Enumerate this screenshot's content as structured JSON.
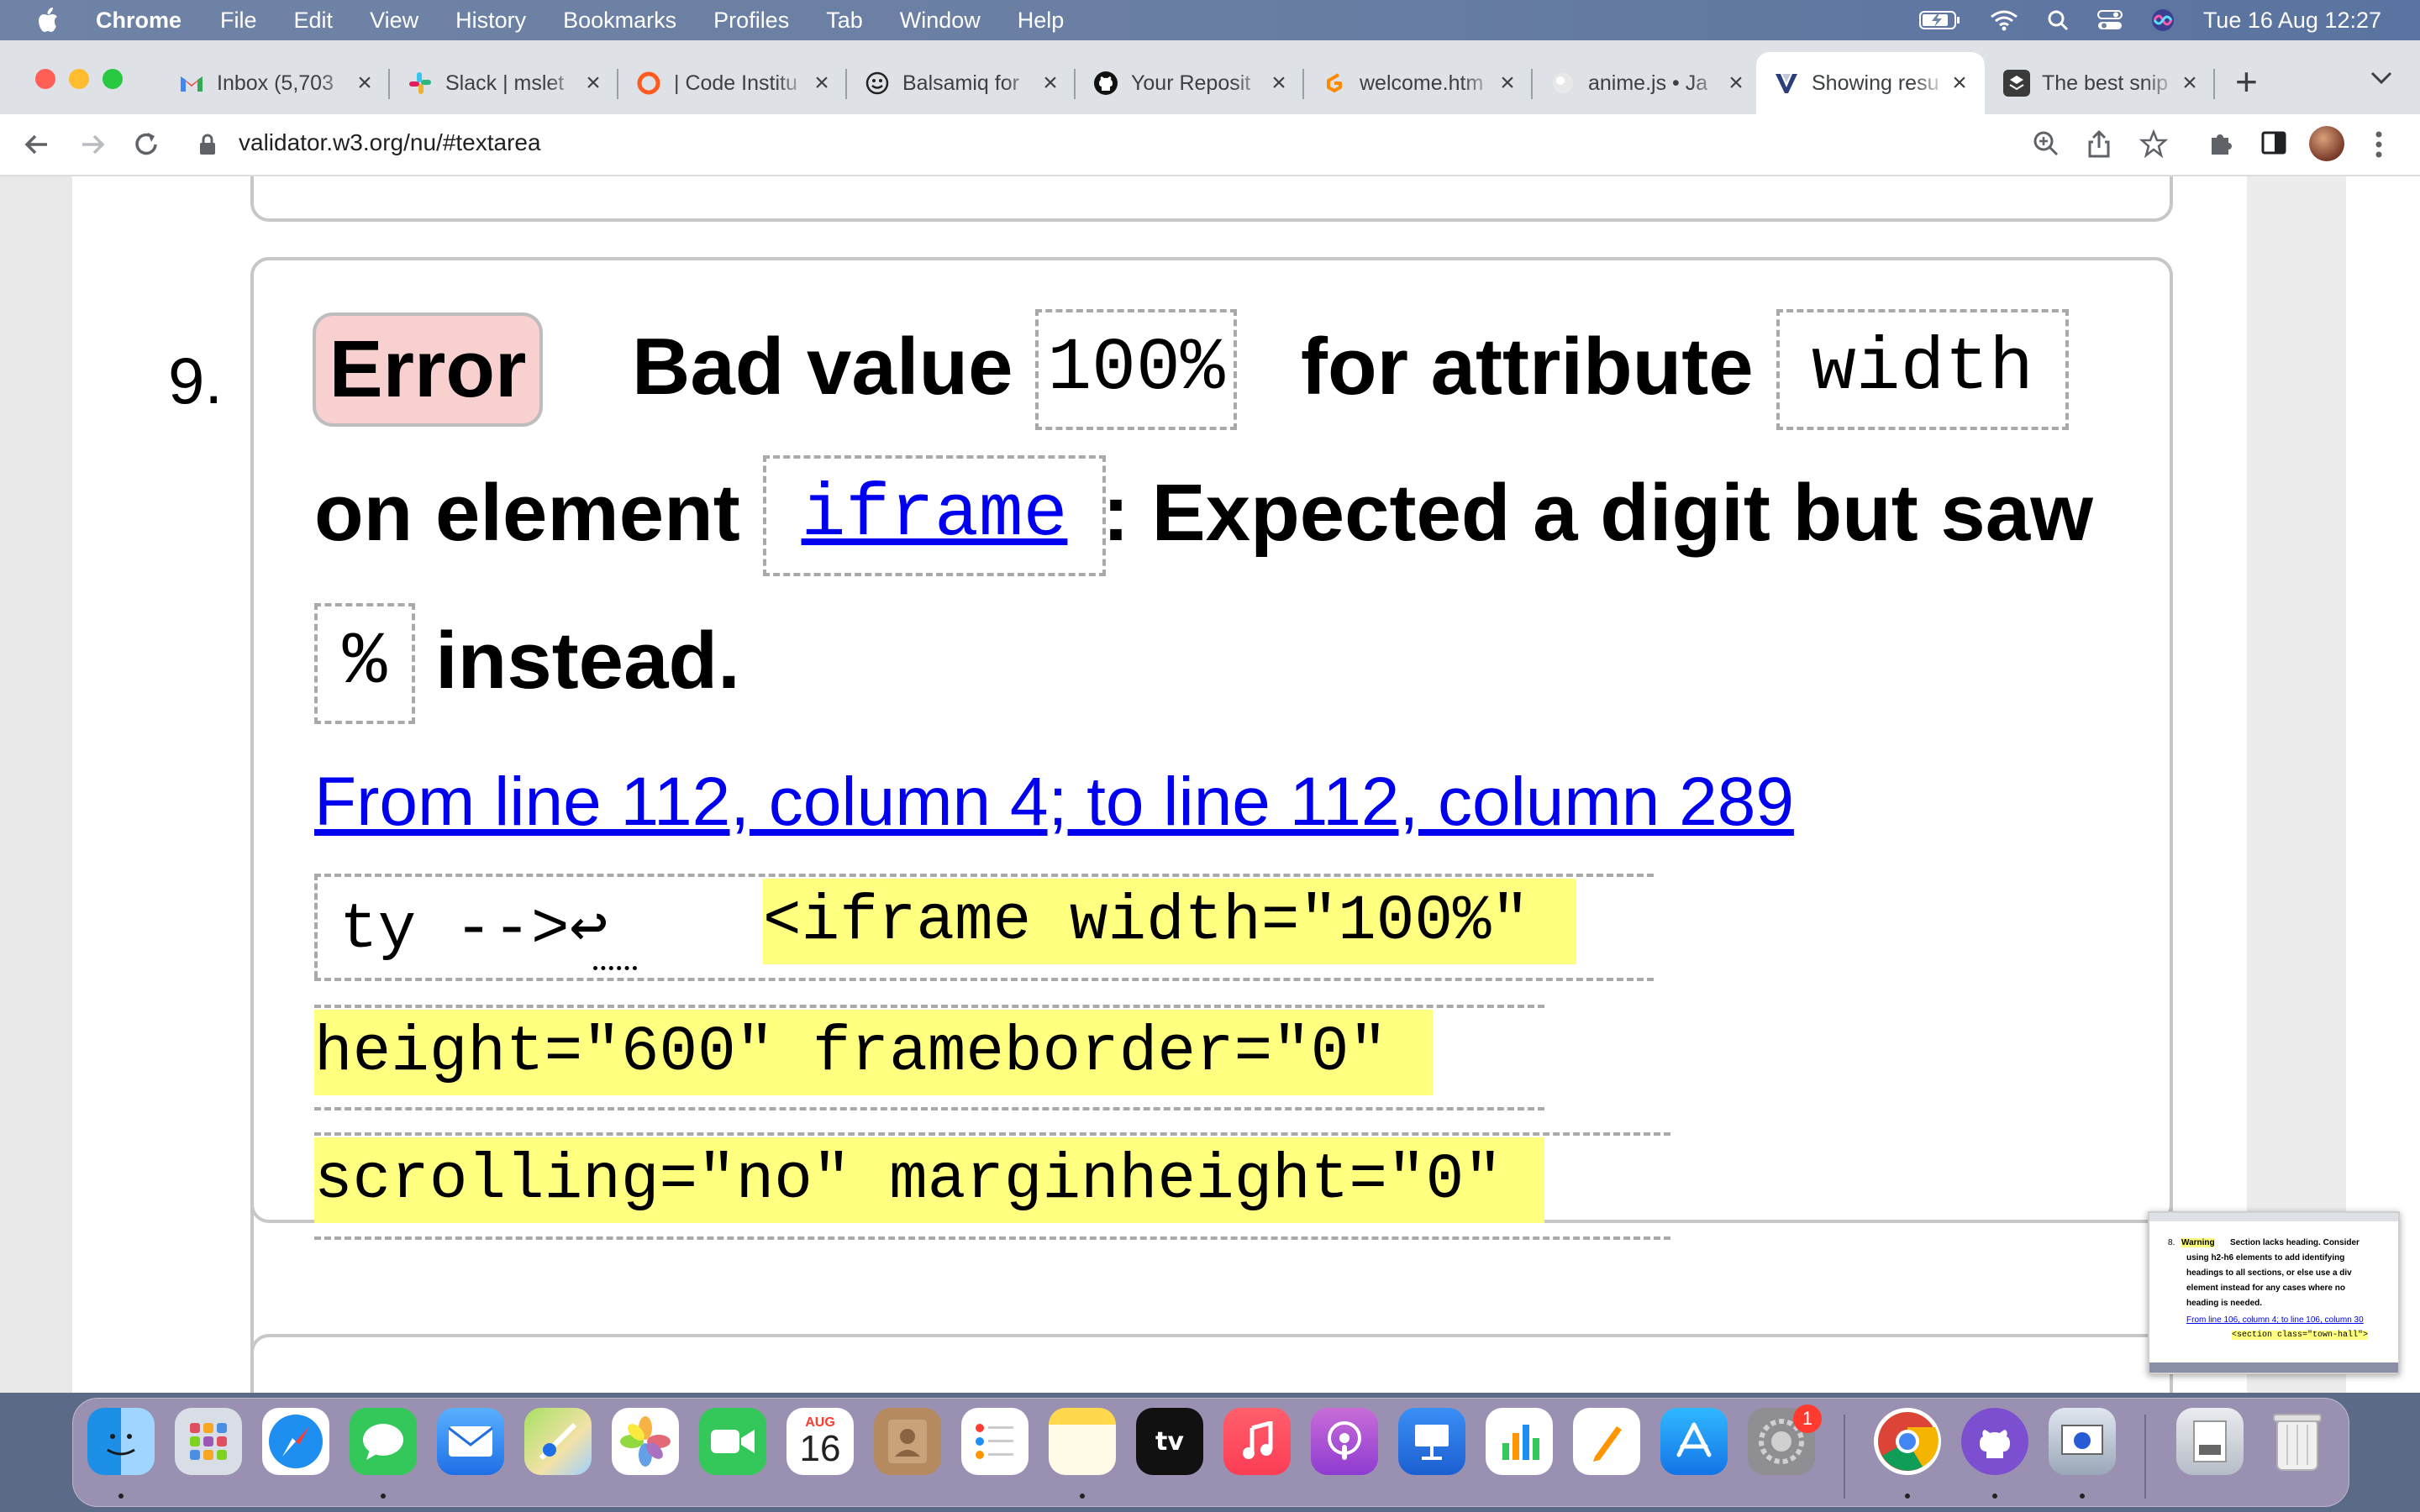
{
  "menubar": {
    "app_name": "Chrome",
    "items": [
      "File",
      "Edit",
      "View",
      "History",
      "Bookmarks",
      "Profiles",
      "Tab",
      "Window",
      "Help"
    ],
    "clock": "Tue 16 Aug  12:27"
  },
  "tabs": [
    {
      "title": "Inbox (5,703",
      "icon": "gmail-icon",
      "active": false
    },
    {
      "title": "Slack | mslet",
      "icon": "slack-icon",
      "active": false
    },
    {
      "title": "| Code Institu",
      "icon": "code-institute-icon",
      "active": false
    },
    {
      "title": "Balsamiq for",
      "icon": "balsamiq-icon",
      "active": false
    },
    {
      "title": "Your Reposit",
      "icon": "github-icon",
      "active": false
    },
    {
      "title": "welcome.htm",
      "icon": "gitpod-icon",
      "active": false
    },
    {
      "title": "anime.js • Ja",
      "icon": "animejs-icon",
      "active": false
    },
    {
      "title": "Showing resu",
      "icon": "w3c-validator-icon",
      "active": true
    },
    {
      "title": "The best snip",
      "icon": "snippet-icon",
      "active": false
    }
  ],
  "address_bar": {
    "url": "validator.w3.org/nu/#textarea"
  },
  "message": {
    "number": "9.",
    "type_label": "Error",
    "text_bad_value": "Bad value",
    "value_code": "100%",
    "text_for_attribute": "for attribute",
    "attribute_code": "width",
    "text_on_element": "on element",
    "element_code": "iframe",
    "text_expected": ": Expected a digit but saw",
    "saw_code": "%",
    "text_instead": "instead.",
    "location_link": "From line 112, column 4; to line 112, column 289",
    "extract": {
      "line1_context": "ty -->↩",
      "line1_highlight": "<iframe width=\"100%\"",
      "line2_highlight": "height=\"600\" frameborder=\"0\"",
      "line3_highlight": "scrolling=\"no\" marginheight=\"0\""
    }
  },
  "thumbnail": {
    "number": "8.",
    "type_label": "Warning",
    "line1": "Section lacks heading. Consider",
    "line2": "using h2-h6 elements to add identifying",
    "line3": "headings to all sections, or else use a div",
    "line4": "element instead for any cases where no",
    "line5": "heading is needed.",
    "link": "From line 106, column 4; to line 106, column 30",
    "code": "<section class=\"town-hall\">"
  },
  "dock": {
    "calendar_month": "AUG",
    "calendar_day": "16",
    "settings_badge": "1",
    "apps": [
      "Finder",
      "Launchpad",
      "Safari",
      "Messages",
      "Mail",
      "Maps",
      "Photos",
      "FaceTime",
      "Calendar",
      "Contacts",
      "Reminders",
      "Notes",
      "TV",
      "Music",
      "Podcasts",
      "Keynote",
      "Numbers",
      "Pages",
      "App Store",
      "System Preferences",
      "Google Chrome",
      "GitHub Desktop",
      "Preview",
      "Downloads",
      "Trash"
    ]
  },
  "colors": {
    "error_badge_bg": "#f8d0d0",
    "highlight": "#ffff80",
    "link": "#0000ee"
  }
}
